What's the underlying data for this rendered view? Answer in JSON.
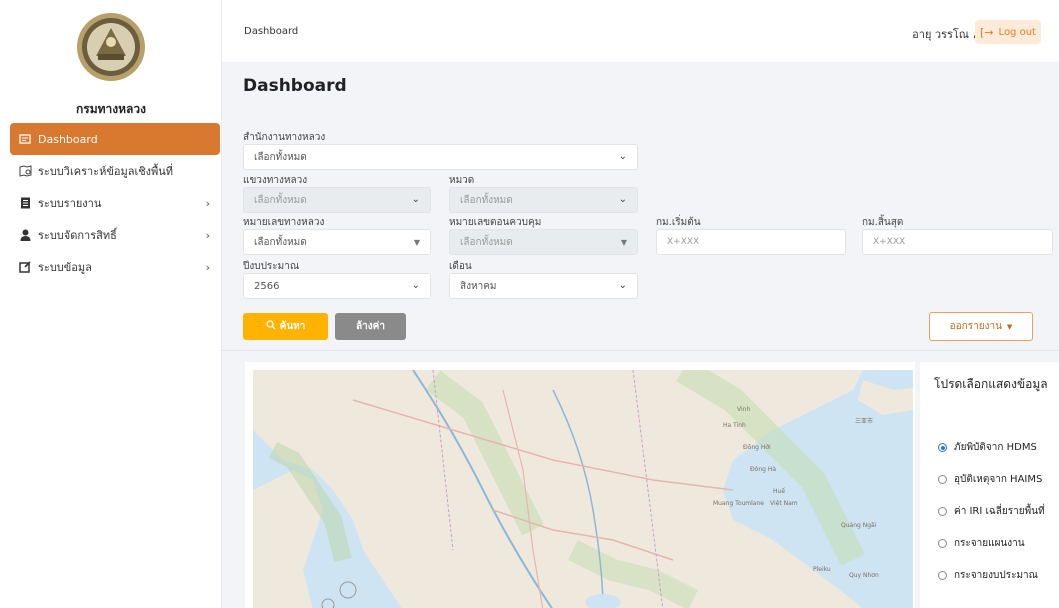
{
  "sidebar": {
    "org_name": "กรมทางหลวง",
    "items": [
      {
        "label": "Dashboard",
        "icon": "dashboard-icon",
        "active": true
      },
      {
        "label": "ระบบวิเคราะห์ข้อมูลเชิงพื้นที่",
        "icon": "spatial-analysis-icon"
      },
      {
        "label": "ระบบรายงาน",
        "icon": "report-icon"
      },
      {
        "label": "ระบบจัดการสิทธิ์",
        "icon": "user-permission-icon"
      },
      {
        "label": "ระบบข้อมูล",
        "icon": "data-edit-icon"
      }
    ]
  },
  "header": {
    "breadcrumb": "Dashboard",
    "user_name": "อายุ วรรโณ",
    "logout_label": "Log out"
  },
  "page": {
    "title": "Dashboard"
  },
  "filters": {
    "office_label": "สำนักงานทางหลวง",
    "office_value": "เลือกทั้งหมด",
    "district_label": "แขวงทางหลวง",
    "district_value": "เลือกทั้งหมด",
    "category_label": "หมวด",
    "category_value": "เลือกทั้งหมด",
    "road_no_label": "หมายเลขทางหลวง",
    "road_no_value": "เลือกทั้งหมด",
    "control_no_label": "หมายเลขตอนควบคุม",
    "control_no_value": "เลือกทั้งหมด",
    "km_start_label": "กม.เริ่มต้น",
    "km_start_placeholder": "X+XXX",
    "km_end_label": "กม.สิ้นสุด",
    "km_end_placeholder": "X+XXX",
    "budget_year_label": "ปีงบประมาณ",
    "budget_year_value": "2566",
    "month_label": "เดือน",
    "month_value": "สิงหาคม"
  },
  "actions": {
    "search_label": "ค้นหา",
    "clear_label": "ล้างค่า",
    "export_label": "ออกรายงาน"
  },
  "map": {
    "labels": [
      "Vinh",
      "Ha Tinh",
      "Đồng Hới",
      "Đông Hà",
      "Huế",
      "Việt Nam",
      "Quảng Ngãi",
      "Pleiku",
      "Quy Nhơn",
      "Muang Toumlane",
      "三亚市"
    ]
  },
  "layers": {
    "title": "โปรดเลือกแสดงข้อมูล",
    "options": [
      {
        "label": "ภัยพิบัติจาก HDMS",
        "checked": true
      },
      {
        "label": "อุบัติเหตุจาก HAIMS",
        "checked": false
      },
      {
        "label": "ค่า IRI เฉลี่ยรายพื้นที่",
        "checked": false
      },
      {
        "label": "กระจายแผนงาน",
        "checked": false
      },
      {
        "label": "กระจายงบประมาณ",
        "checked": false
      }
    ]
  },
  "colors": {
    "accent": "#d9792f",
    "search_button": "#ffb300",
    "clear_button": "#8a8a8a",
    "radio_checked": "#2f6fe0"
  }
}
